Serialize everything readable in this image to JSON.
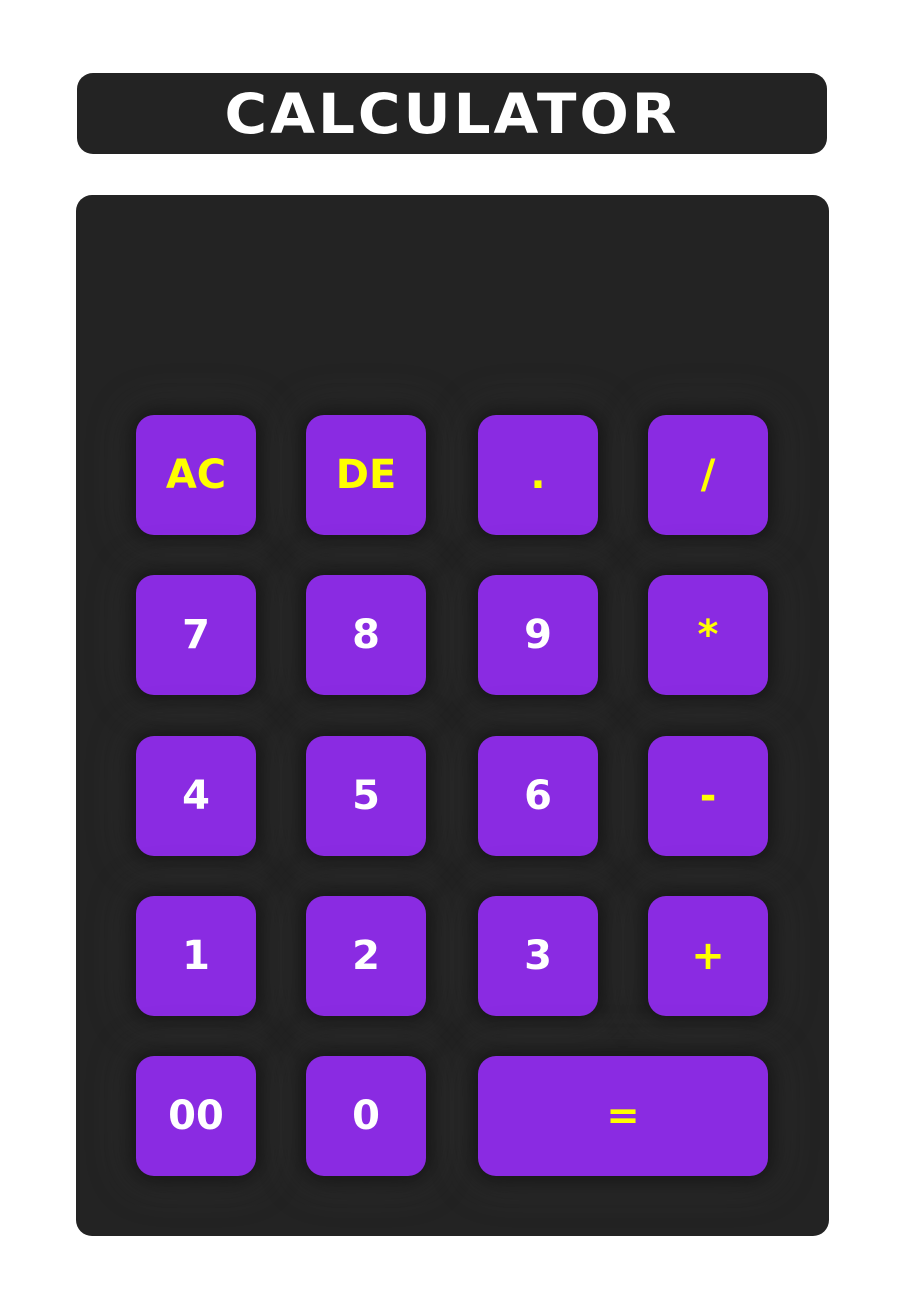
{
  "title": "CALCULATOR",
  "display": {
    "value": ""
  },
  "colors": {
    "page_bg": "#ffffff",
    "panel_bg": "#232323",
    "key_bg": "#8a2be2",
    "digit_text": "#ffffff",
    "operator_text": "#ffff00"
  },
  "keys": {
    "ac": "AC",
    "de": "DE",
    "dot": ".",
    "divide": "/",
    "seven": "7",
    "eight": "8",
    "nine": "9",
    "multiply": "*",
    "four": "4",
    "five": "5",
    "six": "6",
    "minus": "-",
    "one": "1",
    "two": "2",
    "three": "3",
    "plus": "+",
    "double_zero": "00",
    "zero": "0",
    "equals": "="
  }
}
